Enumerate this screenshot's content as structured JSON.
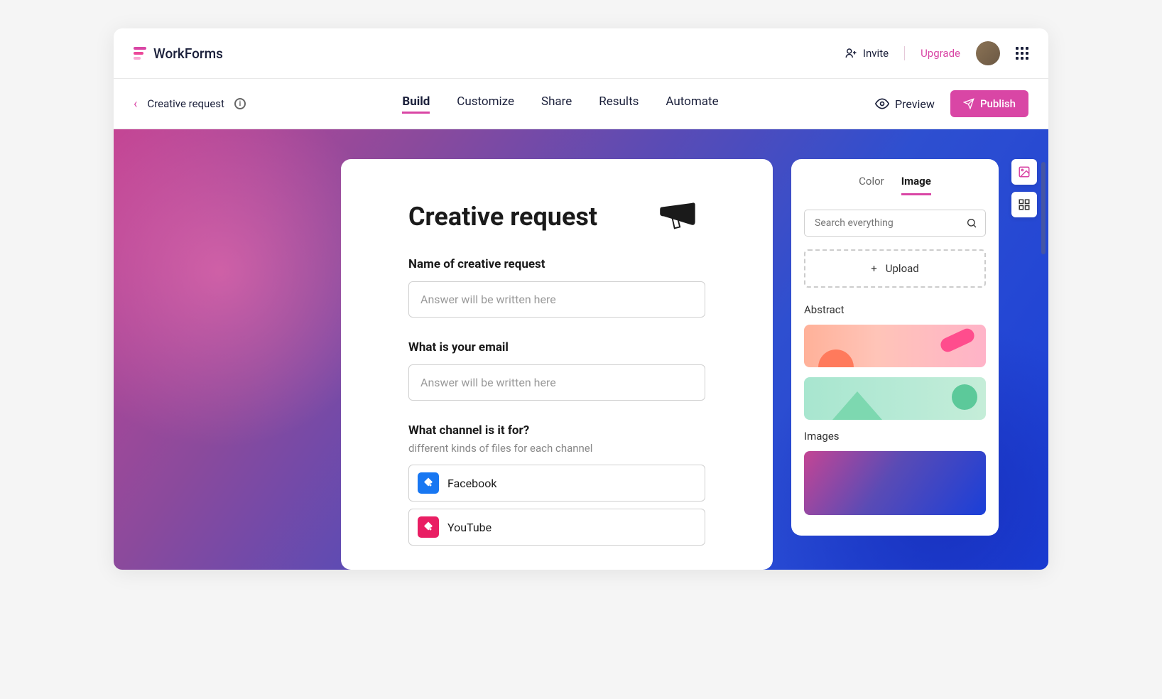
{
  "header": {
    "brand": "WorkForms",
    "invite": "Invite",
    "upgrade": "Upgrade"
  },
  "nav": {
    "breadcrumb": "Creative request",
    "tabs": [
      "Build",
      "Customize",
      "Share",
      "Results",
      "Automate"
    ],
    "active_tab": 0,
    "preview": "Preview",
    "publish": "Publish"
  },
  "form": {
    "title": "Creative request",
    "fields": [
      {
        "label": "Name of creative request",
        "placeholder": "Answer will be written here"
      },
      {
        "label": "What is your email",
        "placeholder": "Answer will be written here"
      }
    ],
    "channel": {
      "label": "What channel is it for?",
      "sublabel": "different kinds of files for each channel",
      "options": [
        "Facebook",
        "YouTube"
      ]
    }
  },
  "panel": {
    "tabs": [
      "Color",
      "Image"
    ],
    "active_tab": 1,
    "search_placeholder": "Search everything",
    "upload": "Upload",
    "sections": [
      "Abstract",
      "Images"
    ]
  }
}
